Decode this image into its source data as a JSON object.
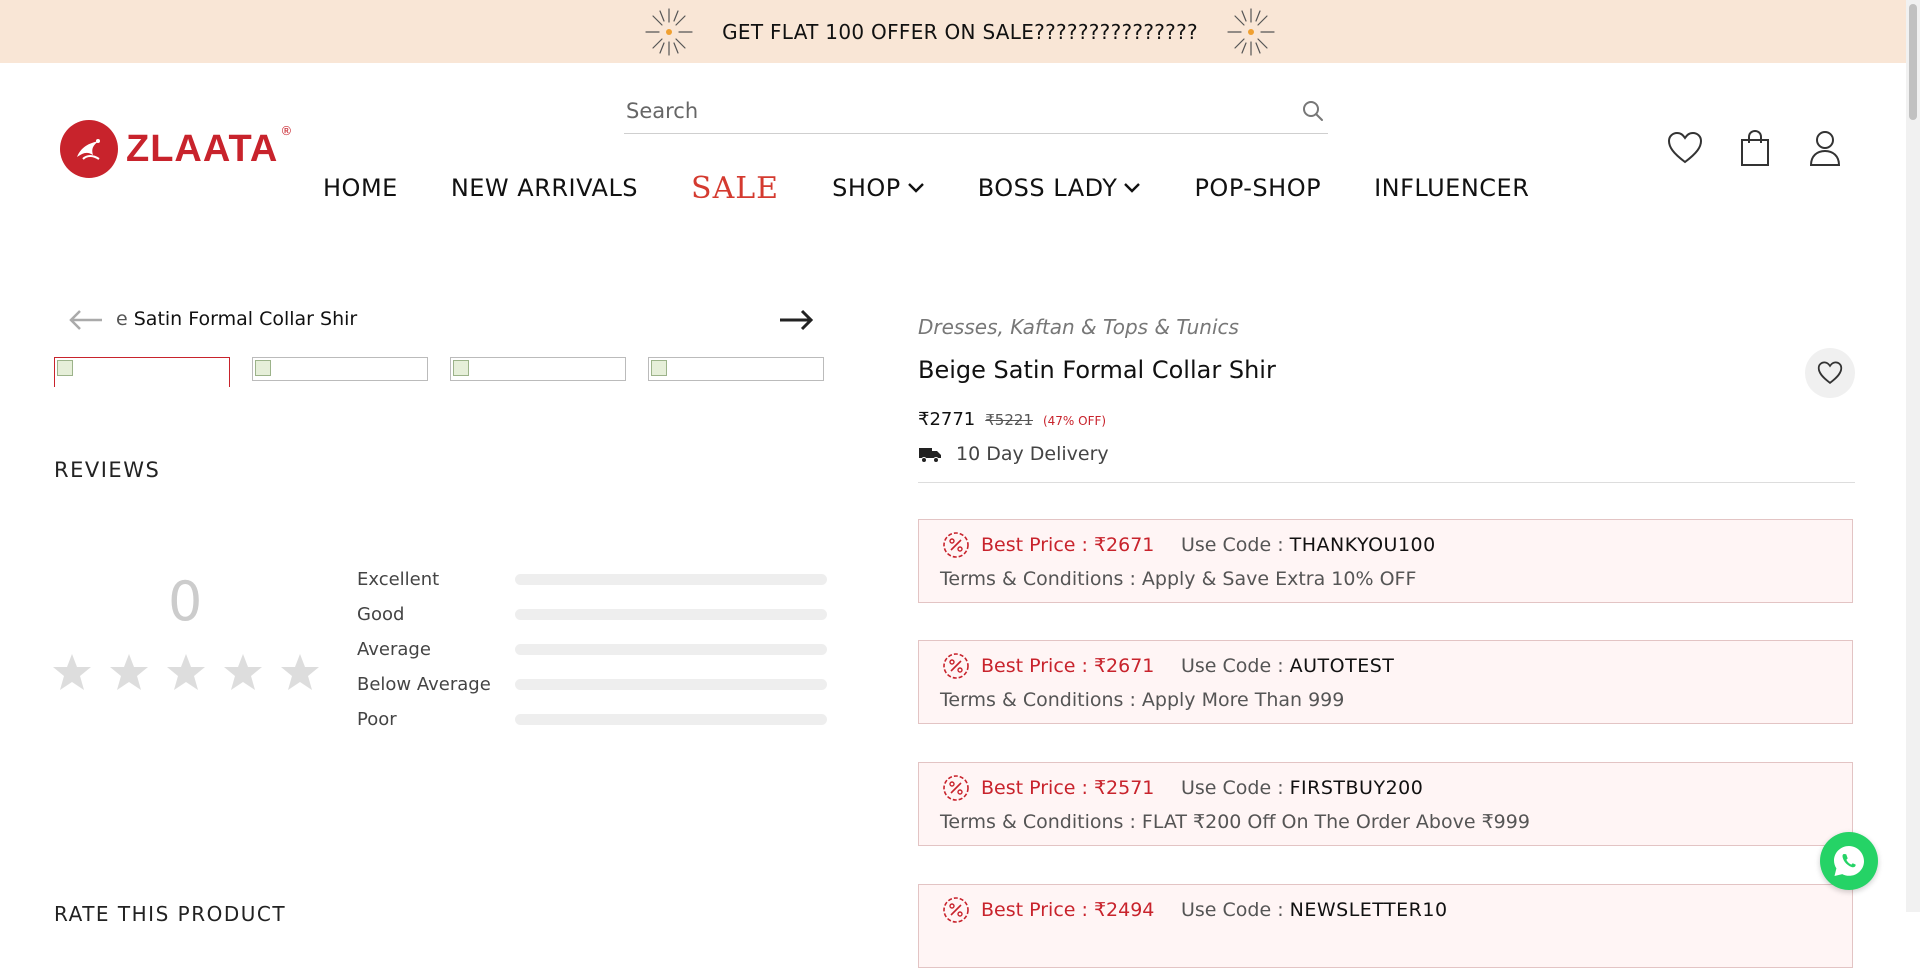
{
  "announcement": {
    "text": "GET FLAT 100 OFFER ON SALE???????????????"
  },
  "brand": {
    "name": "ZLAATA",
    "registered": "®",
    "color": "#c8232c"
  },
  "search": {
    "placeholder": "Search"
  },
  "nav": {
    "home": "HOME",
    "new_arrivals": "NEW ARRIVALS",
    "sale": "SALE",
    "shop": "SHOP",
    "boss_lady": "BOSS LADY",
    "pop_shop": "POP-SHOP",
    "influencer": "INFLUENCER"
  },
  "gallery": {
    "caption_partial": "e",
    "caption": "Satin Formal Collar Shir"
  },
  "reviews": {
    "title": "REVIEWS",
    "score": "0",
    "stars": 0,
    "rows": [
      {
        "label": "Excellent",
        "level": 0
      },
      {
        "label": "Good",
        "level": 0
      },
      {
        "label": "Average",
        "level": 0
      },
      {
        "label": "Below Average",
        "level": 0
      },
      {
        "label": "Poor",
        "level": 0
      }
    ],
    "rate_product": "RATE THIS PRODUCT"
  },
  "product": {
    "categories": "Dresses, Kaftan & Tops & Tunics",
    "title": "Beige Satin Formal Collar Shir",
    "price": "₹2771",
    "mrp": "₹5221",
    "discount": "(47% OFF)",
    "delivery": "10 Day Delivery"
  },
  "offers": [
    {
      "best_price": "Best Price : ₹2671",
      "code_label": "Use Code :",
      "code": "THANKYOU100",
      "terms": "Terms & Conditions : Apply & Save Extra 10% OFF"
    },
    {
      "best_price": "Best Price : ₹2671",
      "code_label": "Use Code :",
      "code": "AUTOTEST",
      "terms": "Terms & Conditions : Apply More Than 999"
    },
    {
      "best_price": "Best Price : ₹2571",
      "code_label": "Use Code :",
      "code": "FIRSTBUY200",
      "terms": "Terms & Conditions : FLAT ₹200 Off On The Order Above ₹999"
    },
    {
      "best_price": "Best Price : ₹2494",
      "code_label": "Use Code :",
      "code": "NEWSLETTER10",
      "terms": ""
    }
  ],
  "colors": {
    "announcement_bg": "#f9e6d6",
    "accent": "#c8232c",
    "offer_bg": "#fff5f5",
    "whatsapp": "#25d366"
  }
}
